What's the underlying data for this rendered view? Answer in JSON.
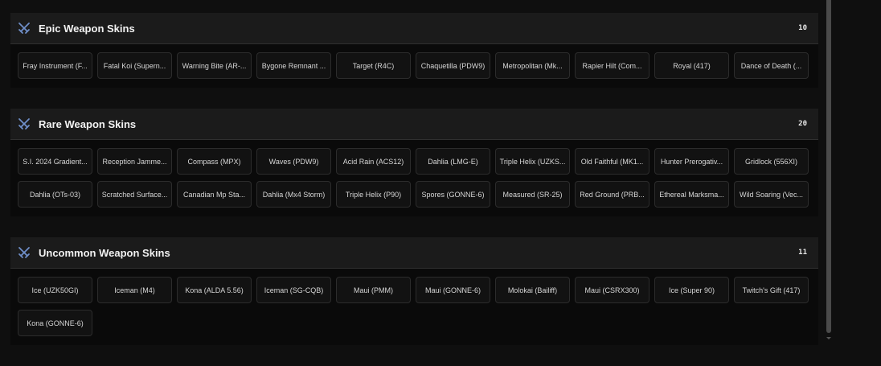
{
  "sections": [
    {
      "title": "Epic Weapon Skins",
      "count": "10",
      "icon": "crossed-swords-icon",
      "items": [
        "Fray Instrument (F...",
        "Fatal Koi (Supern...",
        "Warning Bite (AR-...",
        "Bygone Remnant ...",
        "Target (R4C)",
        "Chaquetilla (PDW9)",
        "Metropolitan (Mk...",
        "Rapier Hilt (Com...",
        "Royal (417)",
        "Dance of Death (..."
      ]
    },
    {
      "title": "Rare Weapon Skins",
      "count": "20",
      "icon": "crossed-swords-icon",
      "items": [
        "S.I. 2024 Gradient...",
        "Reception Jamme...",
        "Compass (MPX)",
        "Waves (PDW9)",
        "Acid Rain (ACS12)",
        "Dahlia (LMG-E)",
        "Triple Helix (UZKS...",
        "Old Faithful (MK1...",
        "Hunter Prerogativ...",
        "Gridlock (556XI)",
        "Dahlia (OTs-03)",
        "Scratched Surface...",
        "Canadian Mp Sta...",
        "Dahlia (Mx4 Storm)",
        "Triple Helix (P90)",
        "Spores (GONNE-6)",
        "Measured (SR-25)",
        "Red Ground (PRB...",
        "Ethereal Marksma...",
        "Wild Soaring (Vec..."
      ]
    },
    {
      "title": "Uncommon Weapon Skins",
      "count": "11",
      "icon": "crossed-swords-icon",
      "items": [
        "Ice (UZK50GI)",
        "Iceman (M4)",
        "Kona (ALDA 5.56)",
        "Iceman (SG-CQB)",
        "Maui (PMM)",
        "Maui (GONNE-6)",
        "Molokai (Bailiff)",
        "Maui (CSRX300)",
        "Ice (Super 90)",
        "Twitch's Gift (417)",
        "Kona (GONNE-6)"
      ]
    }
  ],
  "colors": {
    "icon": "#6f8fc9",
    "header_bg": "#1b1b1b",
    "card_bg": "#121212"
  }
}
